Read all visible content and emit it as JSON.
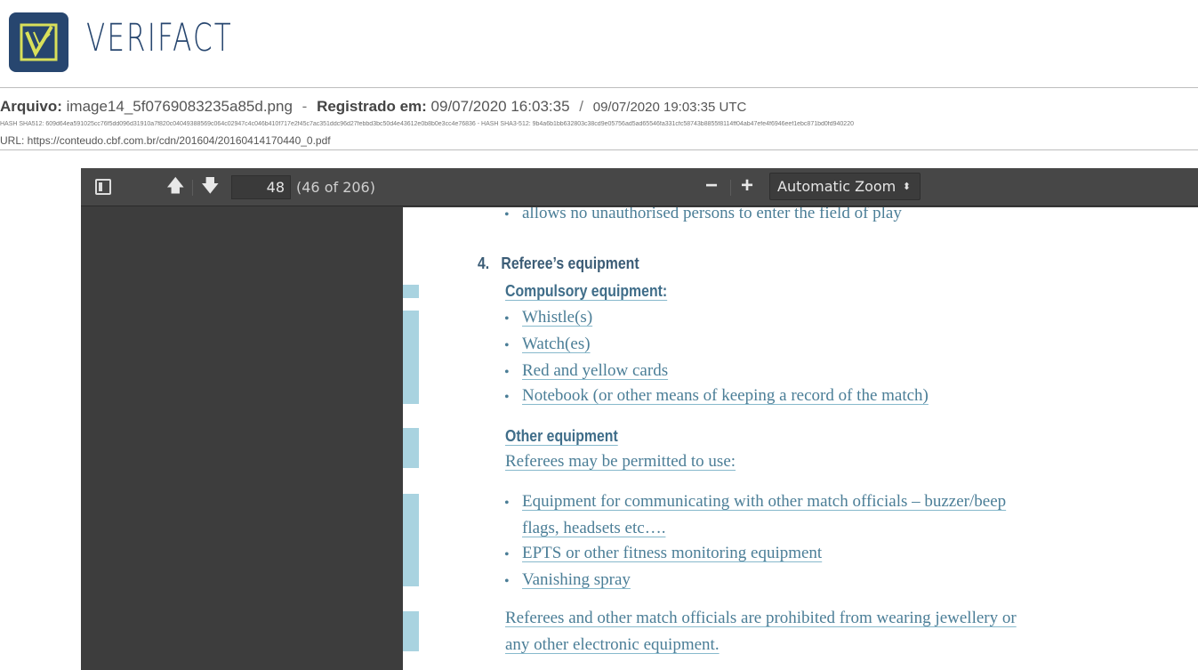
{
  "brand": {
    "name": "VERIFACT"
  },
  "info": {
    "file_label": "Arquivo:",
    "file_name": "image14_5f0769083235a85d.png",
    "sep1": "-",
    "registered_label": "Registrado em:",
    "registered_local": "09/07/2020 16:03:35",
    "sep2": "/",
    "registered_utc": "09/07/2020 19:03:35 UTC",
    "hash_line": "HASH SHA512: 609d64ea591025cc76f5dd096d31910a7f820c04049388569c064c02947c4c046b410f717e2f45c7ac351ddc96d27febbd3bc50d4e43612e0b8b0e3cc4e76836   -   HASH SHA3-512: 9b4a6b1bb632803c38cd9e05756ad5ad65546fa331cfc58743b8855f8114ff04ab47efe4f6946eef1ebc871bd0fd940220",
    "url": "URL: https://conteudo.cbf.com.br/cdn/201604/20160414170440_0.pdf"
  },
  "viewer": {
    "page_number": "48",
    "page_count": "(46 of 206)",
    "zoom": "Automatic Zoom",
    "zoom_out": "−",
    "zoom_in": "+",
    "prev_arrow": "🡅",
    "next_arrow": "🡇",
    "caret": "⬍"
  },
  "document": {
    "line_top": "allows no unauthorised persons to enter the field of play",
    "section_number": "4.",
    "section_title": "Referee’s equipment",
    "compulsory_heading": "Compulsory equipment:",
    "compulsory_items": [
      "Whistle(s)",
      "Watch(es)",
      "Red and yellow cards",
      "Notebook (or other means of keeping a record of the match)"
    ],
    "other_heading": "Other equipment",
    "other_intro": "Referees may be permitted to use:",
    "other_items": [
      "Equipment for communicating with other match officials – buzzer/beep",
      "flags, headsets etc….",
      "EPTS or other fitness monitoring equipment",
      "Vanishing spray"
    ],
    "prohibition_line1": "Referees and other match officials are prohibited from wearing jewellery or",
    "prohibition_line2": "any other electronic equipment."
  },
  "colors": {
    "brand": "#27466f",
    "toolbar": "#474747",
    "sidebar": "#3d3d3d",
    "link_text": "#4b7e97",
    "margin_marker": "#a9d3e0"
  }
}
